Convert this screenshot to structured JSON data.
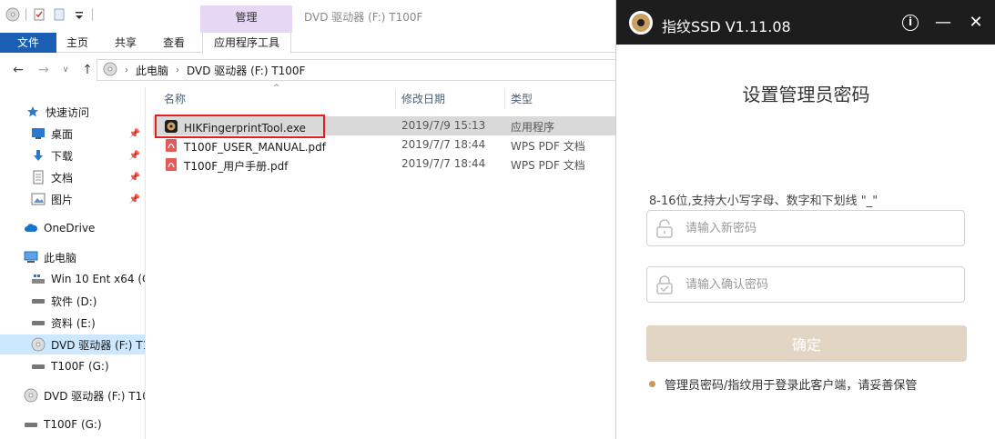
{
  "explorer": {
    "window_title": "DVD 驱动器 (F:) T100F",
    "context_tab_group": "管理",
    "ribbon_tabs": [
      "文件",
      "主页",
      "共享",
      "查看",
      "应用程序工具"
    ],
    "breadcrumb": [
      "此电脑",
      "DVD 驱动器 (F:) T100F"
    ],
    "sidebar": {
      "items": [
        {
          "label": "快速访问",
          "icon": "star-icon"
        },
        {
          "label": "桌面",
          "icon": "desktop-icon",
          "pinned": true
        },
        {
          "label": "下载",
          "icon": "download-icon",
          "pinned": true
        },
        {
          "label": "文档",
          "icon": "document-icon",
          "pinned": true
        },
        {
          "label": "图片",
          "icon": "picture-icon",
          "pinned": true
        },
        {
          "label": "OneDrive",
          "icon": "cloud-icon"
        },
        {
          "label": "此电脑",
          "icon": "computer-icon"
        },
        {
          "label": "Win 10 Ent x64 (C",
          "icon": "drive-icon"
        },
        {
          "label": "软件 (D:)",
          "icon": "drive-icon"
        },
        {
          "label": "资料 (E:)",
          "icon": "drive-icon"
        },
        {
          "label": "DVD 驱动器 (F:) T1",
          "icon": "dvd-icon",
          "selected": true
        },
        {
          "label": "T100F (G:)",
          "icon": "drive-icon"
        },
        {
          "label": "DVD 驱动器 (F:) T10",
          "icon": "dvd-icon"
        },
        {
          "label": "T100F (G:)",
          "icon": "drive-icon"
        }
      ]
    },
    "columns": {
      "name": "名称",
      "date": "修改日期",
      "type": "类型"
    },
    "files": [
      {
        "name": "HIKFingerprintTool.exe",
        "date": "2019/7/9 15:13",
        "type": "应用程序",
        "icon": "app-icon",
        "selected": true
      },
      {
        "name": "T100F_USER_MANUAL.pdf",
        "date": "2019/7/7 18:44",
        "type": "WPS PDF 文档",
        "icon": "pdf-icon"
      },
      {
        "name": "T100F_用户手册.pdf",
        "date": "2019/7/7 18:44",
        "type": "WPS PDF 文档",
        "icon": "pdf-icon"
      }
    ]
  },
  "app": {
    "title": "指纹SSD V1.11.08",
    "heading": "设置管理员密码",
    "hint": "8-16位,支持大小写字母、数字和下划线 \"_\"",
    "new_password_placeholder": "请输入新密码",
    "confirm_password_placeholder": "请输入确认密码",
    "confirm_button": "确定",
    "note": "管理员密码/指纹用于登录此客户端，请妥善保管",
    "colors": {
      "header_bg": "#1d1d1d",
      "accent": "#c8975a",
      "button_bg": "#e3d5c4"
    }
  }
}
